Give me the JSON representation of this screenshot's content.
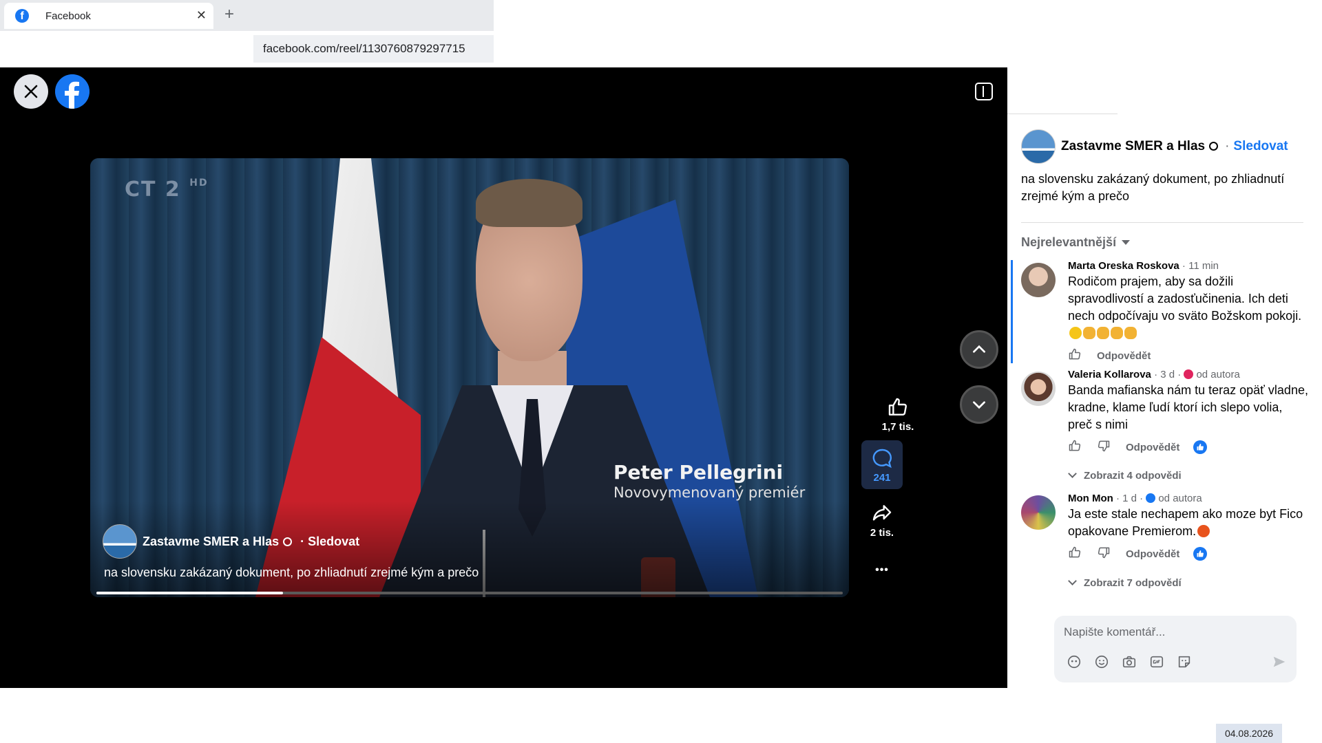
{
  "browser": {
    "tab_title": "Facebook",
    "tab_close": "✕",
    "new_tab": "+",
    "url": "facebook.com/reel/1130760879297715"
  },
  "video": {
    "channel_logo": "CT 2",
    "channel_logo_suffix": "HD",
    "caption_name": "Peter Pellegrini",
    "caption_role": "Novovymenovaný premiér",
    "author": "Zastavme SMER a Hlas",
    "follow_label": "· Sledovat",
    "description": "na slovensku zakázaný dokument, po zhliadnutí zrejmé kým a prečo",
    "progress": 0.25
  },
  "actions": {
    "likes": "1,7 tis.",
    "comments": "241",
    "shares": "2 tis.",
    "more": "•••"
  },
  "post": {
    "author": "Zastavme SMER a Hlas",
    "follow_label": "Sledovat",
    "follow_sep": "·",
    "description": "na slovensku zakázaný dokument, po zhliadnutí zrejmé kým a prečo",
    "sort_label": "Nejrelevantnější"
  },
  "comments": [
    {
      "author": "Marta Oreska Roskova",
      "time": "· 11 min",
      "badge": "",
      "text": "Rodičom prajem, aby sa dožili spravodlivostí a zadosťučinenia. Ich deti nech odpočívaju vo sväto Božskom pokoji.",
      "reply_label": "Odpovědět"
    },
    {
      "author": "Valeria Kollarova",
      "time": "· 3 d ·",
      "badge": "od autora",
      "text": "Banda mafianska nám tu teraz opäť vladne, kradne, klame ľudí ktorí ich slepo volia, preč s nimi",
      "reply_label": "Odpovědět",
      "replies": "Zobrazit 4 odpovědi"
    },
    {
      "author": "Mon Mon",
      "time": "· 1 d ·",
      "badge": "od autora",
      "text": "Ja este stale nechapem ako moze byt Fico opakovane Premierom.",
      "reply_label": "Odpovědět",
      "replies": "Zobrazit 7 odpovědí"
    }
  ],
  "composer": {
    "placeholder": "Napište komentář..."
  },
  "taskbar": {
    "date": "04.08.2026"
  },
  "colors": {
    "accent": "#1877f2",
    "stage_bg": "#000000",
    "panel_bg": "#ffffff"
  }
}
